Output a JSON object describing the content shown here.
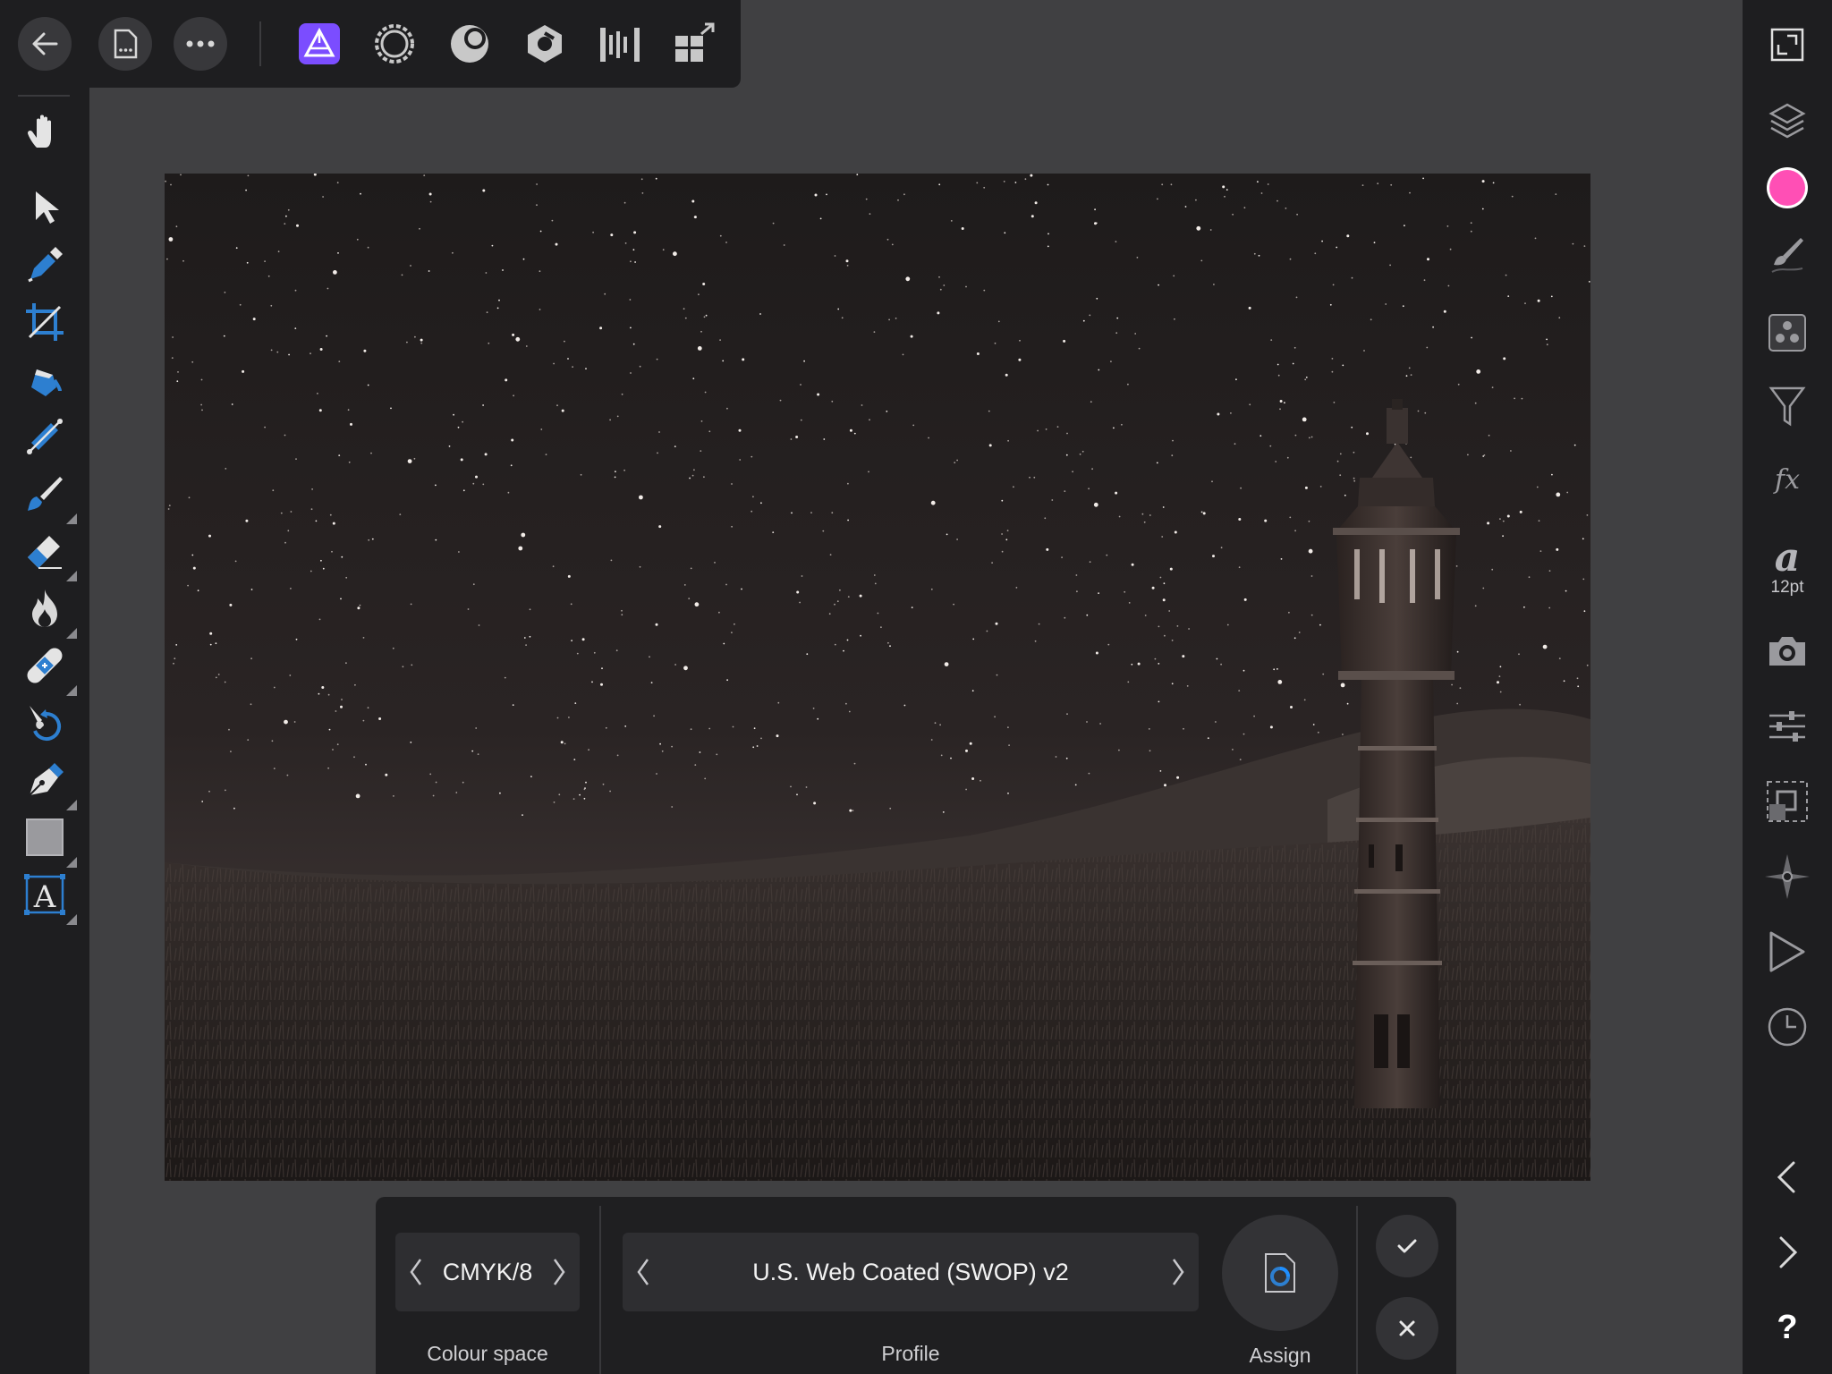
{
  "toolbar": {
    "back": "back-arrow-icon",
    "document": "document-menu-icon",
    "more": "more-icon",
    "personas": [
      "photo-persona",
      "liquify-persona",
      "develop-persona",
      "tone-mapping-persona",
      "export-persona"
    ],
    "accent": "#7b4dff"
  },
  "left_tools": [
    "view-hand-icon",
    "move-arrow-icon",
    "color-picker-icon",
    "crop-icon",
    "flood-fill-icon",
    "gradient-icon",
    "paint-brush-icon",
    "erase-brush-icon",
    "dodge-burn-icon",
    "healing-icon",
    "undo-brush-icon",
    "pen-icon",
    "rectangle-shape-icon",
    "artistic-text-icon"
  ],
  "right_studio": {
    "items": [
      "navigator-icon",
      "layers-icon",
      "colour-icon",
      "brushes-icon",
      "channels-icon",
      "adjustments-icon",
      "effects-icon",
      "text-style-icon",
      "stock-icon",
      "transform-icon",
      "selection-icon",
      "compass-icon",
      "macro-play-icon",
      "history-icon"
    ],
    "colour_swatch": "#ff4fb5",
    "text_size": "12pt",
    "prev": "chevron-left-icon",
    "next": "chevron-right-icon",
    "help": "?"
  },
  "context": {
    "colour_space": {
      "value": "CMYK/8",
      "label": "Colour space"
    },
    "profile": {
      "value": "U.S. Web Coated (SWOP) v2",
      "label": "Profile"
    },
    "assign": {
      "label": "Assign"
    },
    "confirm": "checkmark-icon",
    "cancel": "close-icon"
  }
}
